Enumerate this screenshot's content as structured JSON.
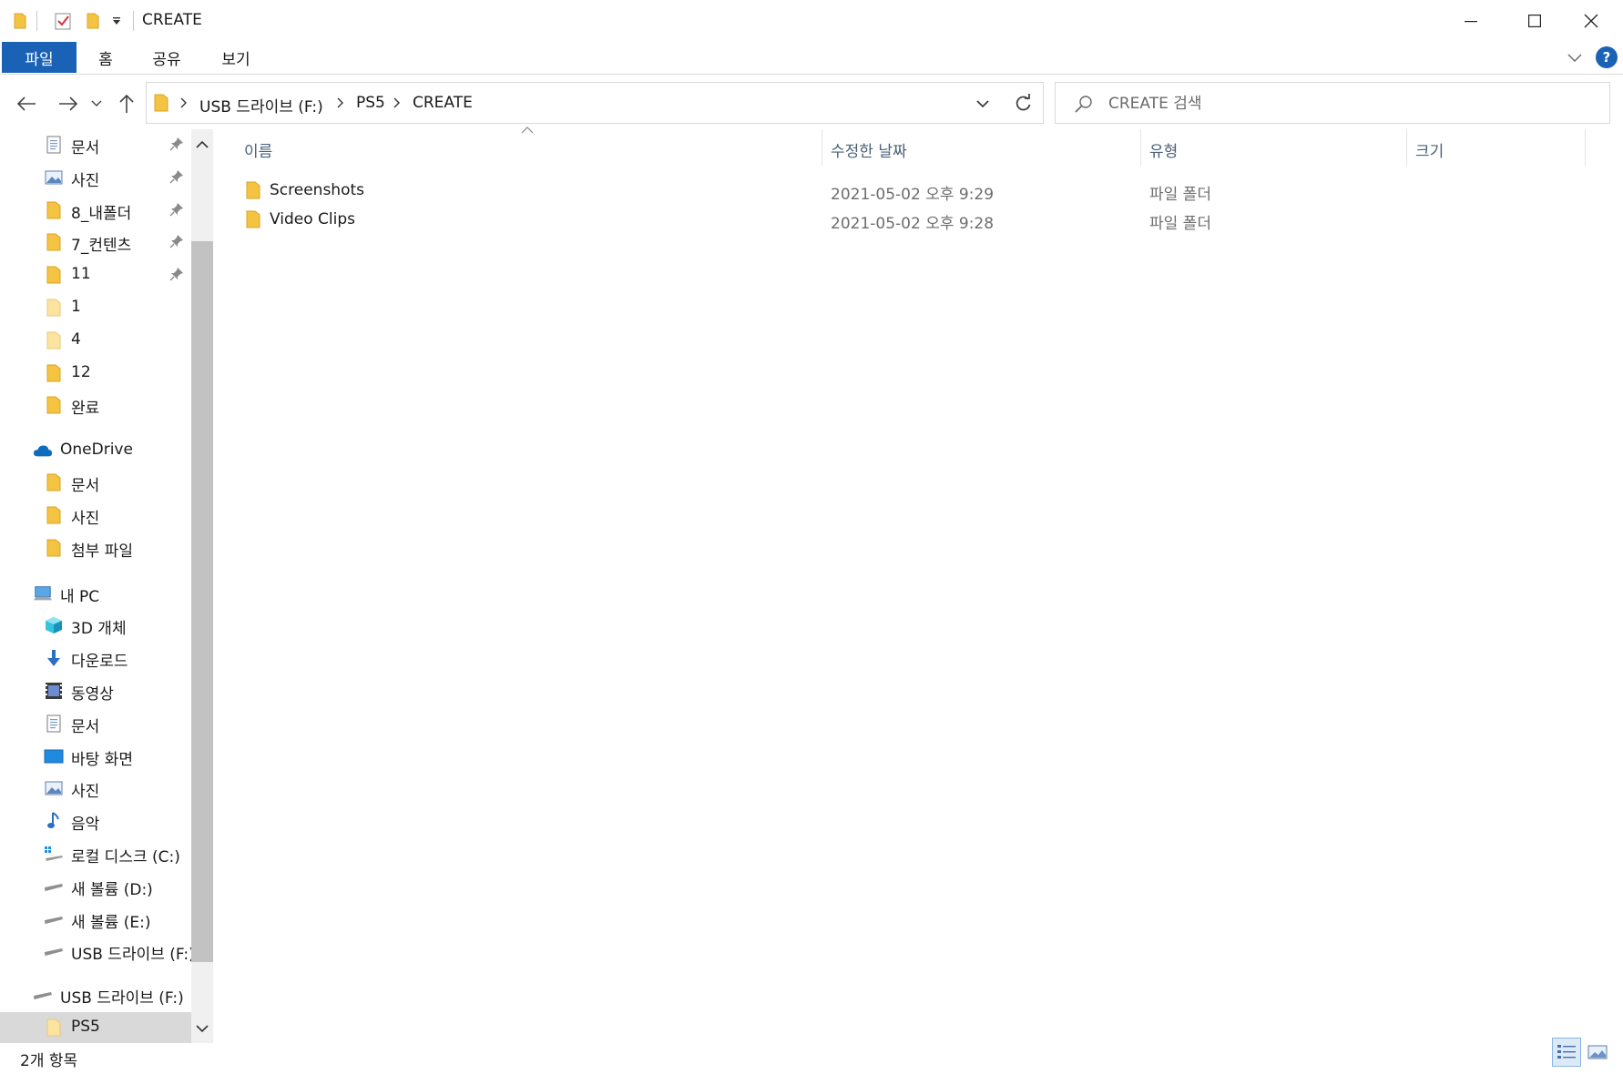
{
  "window": {
    "title": "CREATE"
  },
  "ribbon": {
    "tabs": [
      "파일",
      "홈",
      "공유",
      "보기"
    ],
    "help_label": "?"
  },
  "address": {
    "crumbs": [
      "USB 드라이브 (F:)",
      "PS5",
      "CREATE"
    ]
  },
  "search": {
    "placeholder": "CREATE 검색"
  },
  "nav": {
    "quick_access": [
      {
        "label": "문서",
        "icon": "documents-icon",
        "pinned": true
      },
      {
        "label": "사진",
        "icon": "pictures-icon",
        "pinned": true
      },
      {
        "label": "8_내폴더",
        "icon": "folder-icon",
        "pinned": true
      },
      {
        "label": "7_컨텐츠",
        "icon": "folder-icon",
        "pinned": true
      },
      {
        "label": "11",
        "icon": "folder-icon",
        "pinned": true
      },
      {
        "label": "1",
        "icon": "folder-icon",
        "pinned": false
      },
      {
        "label": "4",
        "icon": "folder-icon",
        "pinned": false
      },
      {
        "label": "12",
        "icon": "folder-icon",
        "pinned": false
      },
      {
        "label": "완료",
        "icon": "folder-icon",
        "pinned": false
      }
    ],
    "onedrive": {
      "label": "OneDrive",
      "items": [
        "문서",
        "사진",
        "첨부 파일"
      ]
    },
    "this_pc": {
      "label": "내 PC",
      "items": [
        {
          "label": "3D 개체",
          "icon": "3d-objects-icon"
        },
        {
          "label": "다운로드",
          "icon": "download-icon"
        },
        {
          "label": "동영상",
          "icon": "videos-icon"
        },
        {
          "label": "문서",
          "icon": "documents-icon"
        },
        {
          "label": "바탕 화면",
          "icon": "desktop-icon"
        },
        {
          "label": "사진",
          "icon": "pictures-icon"
        },
        {
          "label": "음악",
          "icon": "music-icon"
        },
        {
          "label": "로컬 디스크 (C:)",
          "icon": "local-disk-icon"
        },
        {
          "label": "새 볼륨 (D:)",
          "icon": "drive-icon"
        },
        {
          "label": "새 볼륨 (E:)",
          "icon": "drive-icon"
        },
        {
          "label": "USB 드라이브 (F:)",
          "icon": "drive-icon"
        }
      ]
    },
    "usb": {
      "label": "USB 드라이브 (F:)",
      "child": "PS5"
    }
  },
  "columns": {
    "name": "이름",
    "date": "수정한 날짜",
    "type": "유형",
    "size": "크기"
  },
  "files": [
    {
      "name": "Screenshots",
      "date": "2021-05-02 오후 9:29",
      "type": "파일 폴더"
    },
    {
      "name": "Video Clips",
      "date": "2021-05-02 오후 9:28",
      "type": "파일 폴더"
    }
  ],
  "status": {
    "count": "2개 항목"
  },
  "colors": {
    "accent": "#1a62b5",
    "folder": "#f5c342",
    "selected_bg": "#d9d9d9"
  }
}
